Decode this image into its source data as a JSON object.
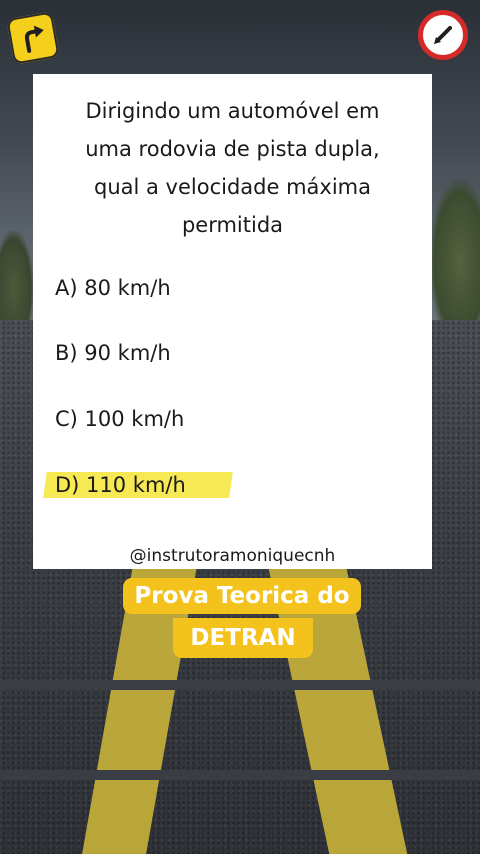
{
  "question": {
    "text": "Dirigindo um automóvel em\numa rodovia de pista dupla,\nqual a velocidade máxima\npermitida"
  },
  "options": [
    {
      "label": "A) 80 km/h"
    },
    {
      "label": "B) 90 km/h"
    },
    {
      "label": "C) 100 km/h"
    },
    {
      "label": "D) 110 km/h",
      "highlighted": true
    }
  ],
  "handle": "@instrutoramoniquecnh",
  "caption": {
    "line1": "Prova Teorica do",
    "line2": "DETRAN"
  },
  "icons": {
    "left": "curve-right-warning-sign-icon",
    "right": "edit-pencil-sign-icon"
  },
  "colors": {
    "highlight": "#f7e84a",
    "caption_bg": "#f4c21d",
    "sign_red": "#d42a2a",
    "sign_yellow": "#f4cf1c"
  }
}
